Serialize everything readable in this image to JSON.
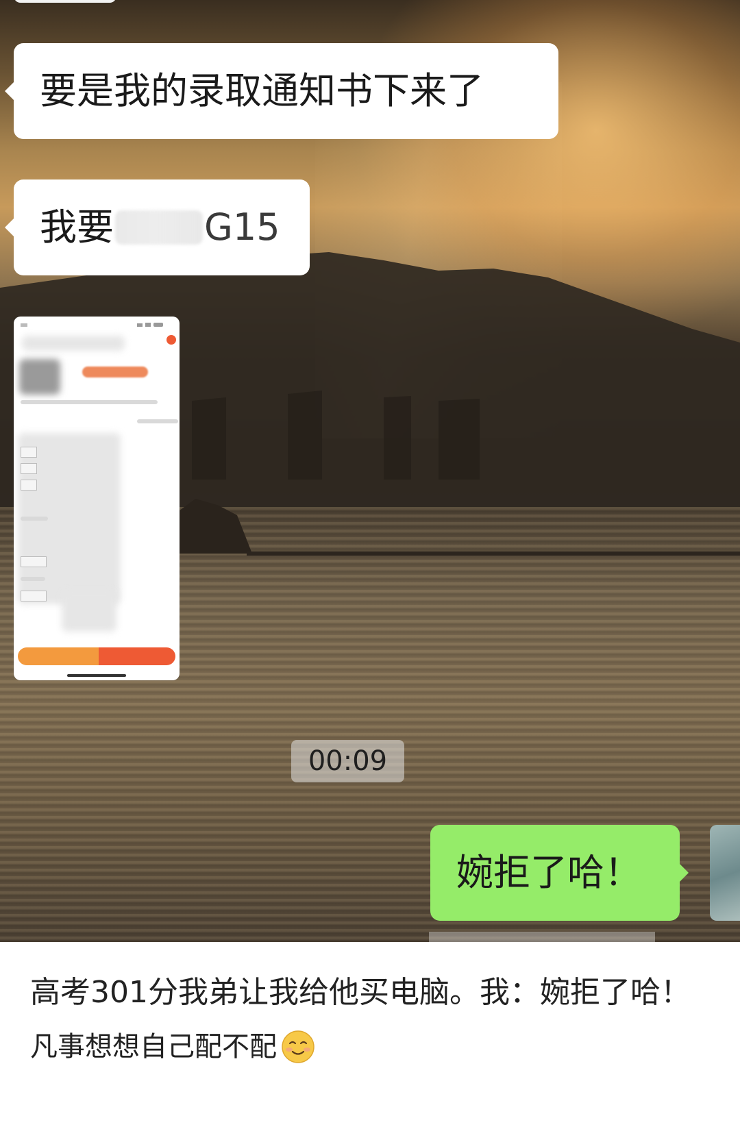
{
  "chat": {
    "messages": [
      {
        "side": "left",
        "text": "要是我的录取通知书下来了"
      },
      {
        "side": "left",
        "text_before": "我要",
        "text_after": "G15",
        "redacted": true
      },
      {
        "side": "left",
        "type": "image",
        "content": "phone-screenshot-thumbnail"
      },
      {
        "side": "right",
        "text": "婉拒了哈！"
      }
    ],
    "timestamp": "00:09",
    "colors": {
      "left_bubble": "#ffffff",
      "right_bubble": "#95ec69"
    }
  },
  "caption": {
    "title": "高考301分我弟让我给他买电脑。我：婉拒了哈！",
    "subtitle": "凡事想想自己配不配",
    "emoji": "smiling-face-icon"
  }
}
